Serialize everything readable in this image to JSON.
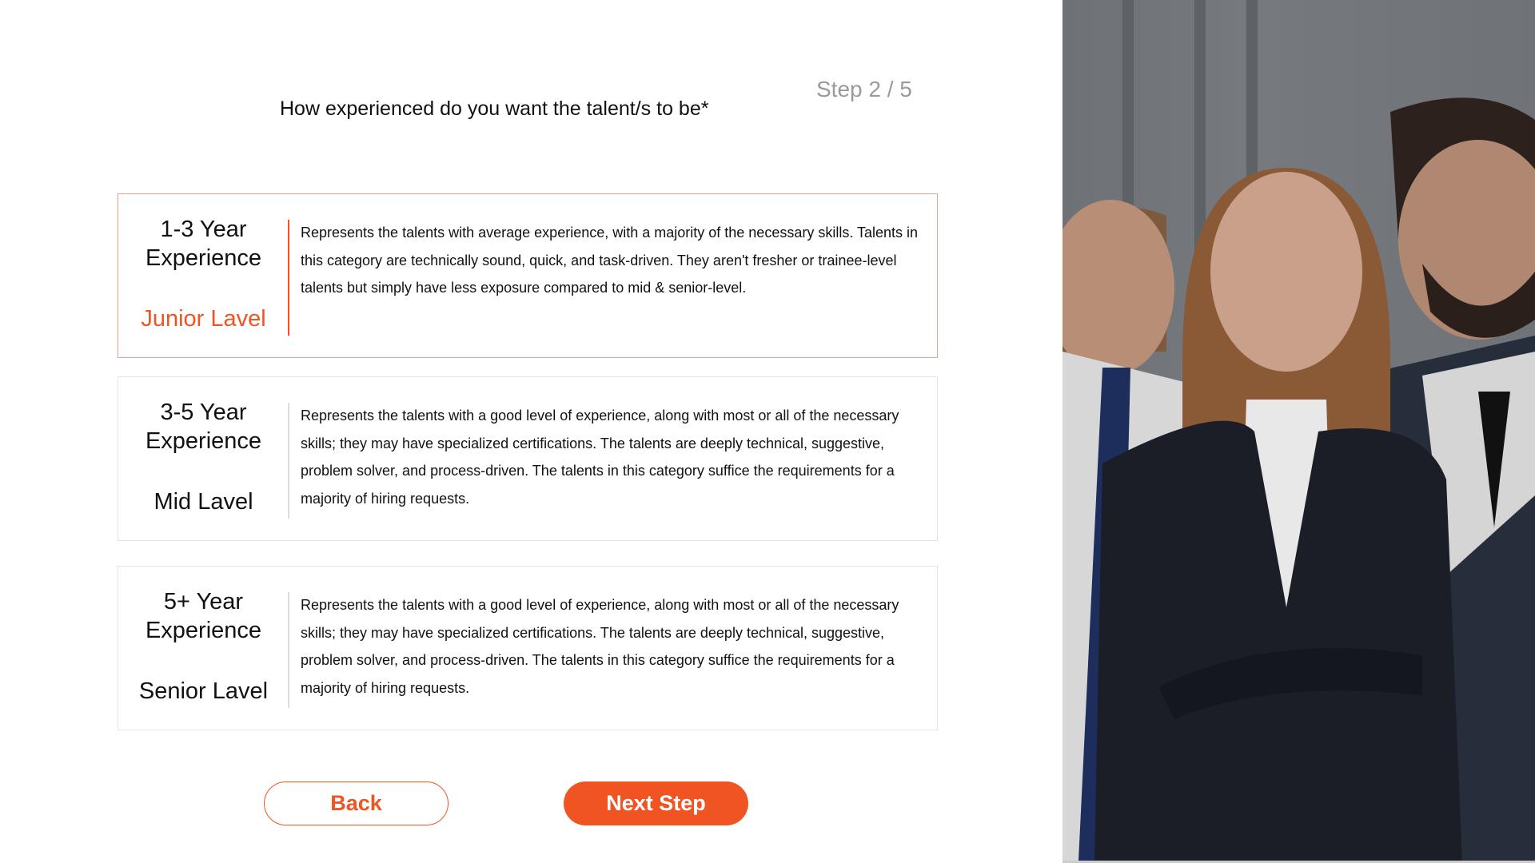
{
  "header": {
    "question": "How experienced do you want the talent/s to be*",
    "step": "Step 2 / 5"
  },
  "options": [
    {
      "title_line1": "1-3 Year",
      "title_line2": "Experience",
      "level": "Junior Lavel",
      "description": "Represents the talents with average experience, with a majority of the necessary skills. Talents in this category are technically sound, quick, and task-driven. They aren't fresher or trainee-level talents but simply have less exposure compared to mid & senior-level.",
      "selected": true
    },
    {
      "title_line1": "3-5 Year",
      "title_line2": "Experience",
      "level": "Mid Lavel",
      "description": "Represents the talents with a good level of experience, along with most or all of the necessary skills; they may have specialized certifications. The talents are deeply technical, suggestive, problem solver, and process-driven. The talents in this category suffice the requirements for a majority of hiring requests.",
      "selected": false
    },
    {
      "title_line1": "5+ Year",
      "title_line2": "Experience",
      "level": "Senior Lavel",
      "description": "Represents the talents with a good level of experience, along with most or all of the necessary skills; they may have specialized certifications. The talents are deeply technical, suggestive, problem solver, and process-driven. The talents in this category suffice the requirements for a majority of hiring requests.",
      "selected": false
    }
  ],
  "buttons": {
    "back": "Back",
    "next": "Next Step"
  },
  "colors": {
    "accent": "#f05423",
    "selected_border": "#f5a08a"
  }
}
